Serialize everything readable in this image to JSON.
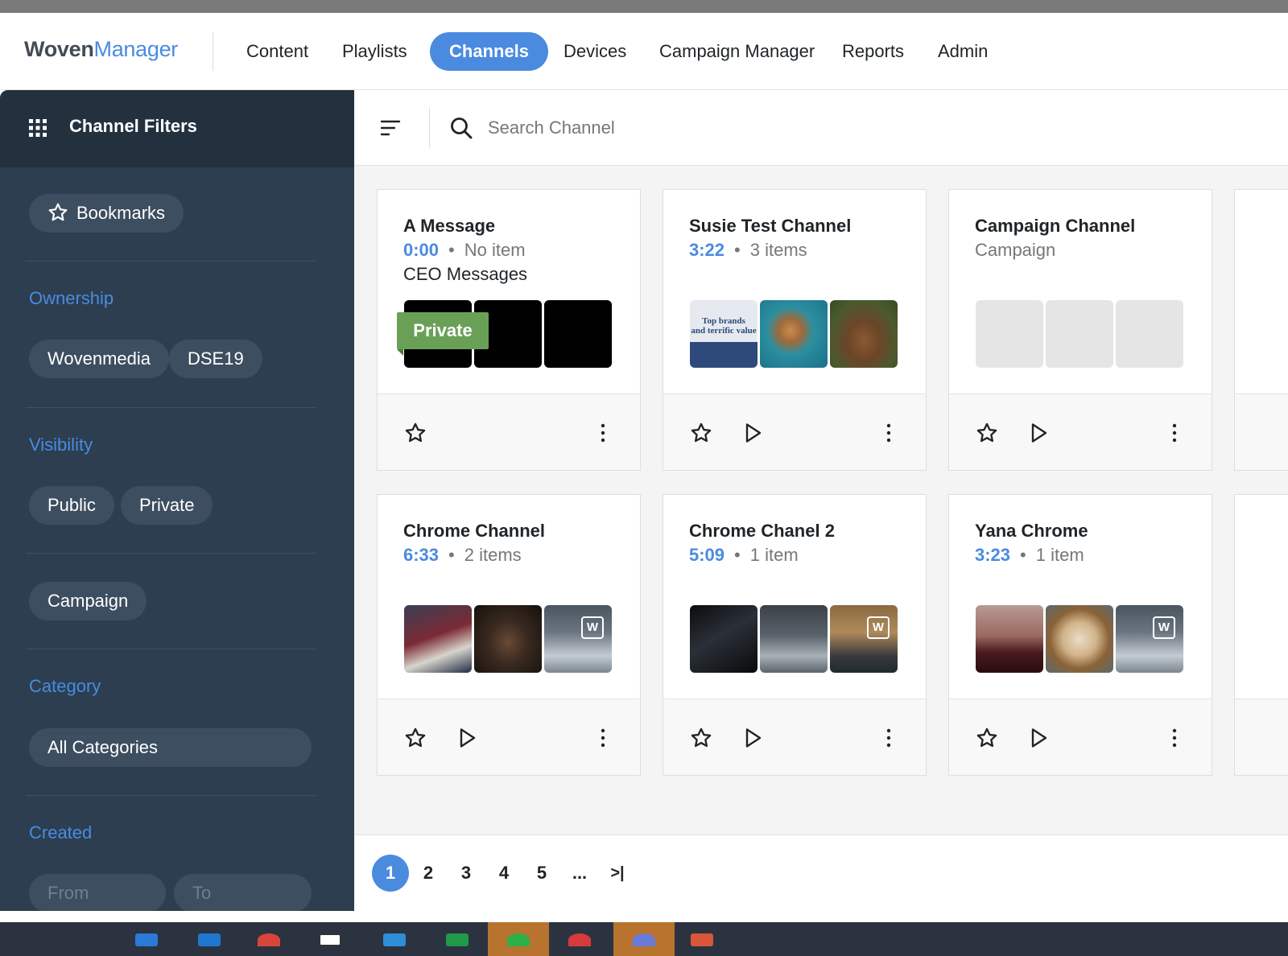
{
  "app": {
    "logo_part1": "Woven",
    "logo_part2": "Manager"
  },
  "nav": {
    "items": [
      "Content",
      "Playlists",
      "Channels",
      "Devices",
      "Campaign Manager",
      "Reports",
      "Admin"
    ],
    "active": "Channels"
  },
  "sidebar": {
    "title": "Channel Filters",
    "bookmarks_label": "Bookmarks",
    "ownership": {
      "label": "Ownership",
      "chips": [
        "Wovenmedia",
        "DSE19"
      ]
    },
    "visibility": {
      "label": "Visibility",
      "chips": [
        "Public",
        "Private"
      ]
    },
    "campaign_chip": "Campaign",
    "category": {
      "label": "Category",
      "value": "All Categories"
    },
    "created": {
      "label": "Created",
      "from_placeholder": "From",
      "to_placeholder": "To"
    }
  },
  "search": {
    "placeholder": "Search Channel"
  },
  "channels": [
    {
      "title": "A Message",
      "duration": "0:00",
      "count": "No item",
      "subtitle": "CEO Messages",
      "private_label": "Private"
    },
    {
      "title": "Susie Test Channel",
      "duration": "3:22",
      "count": "3 items",
      "thumb_text_line1": "Top brands",
      "thumb_text_line2": "and terrific value"
    },
    {
      "title": "Campaign Channel",
      "type_label": "Campaign"
    },
    {
      "title": "Chrome Channel",
      "duration": "6:33",
      "count": "2 items"
    },
    {
      "title": "Chrome Chanel 2",
      "duration": "5:09",
      "count": "1 item"
    },
    {
      "title": "Yana Chrome",
      "duration": "3:23",
      "count": "1 item"
    }
  ],
  "thumb_badge": "W",
  "dot_separator": "•",
  "pagination": {
    "pages": [
      "1",
      "2",
      "3",
      "4",
      "5"
    ],
    "ellipsis": "...",
    "last_symbol": ">|",
    "current": "1"
  },
  "colors": {
    "accent": "#4a8be0",
    "sidebar_bg": "#2c3e50",
    "private_tag": "#6aa056"
  },
  "icons": [
    "grid-icon",
    "star-icon",
    "filter-list-icon",
    "search-icon",
    "play-icon",
    "more-vertical-icon",
    "last-page-icon"
  ]
}
